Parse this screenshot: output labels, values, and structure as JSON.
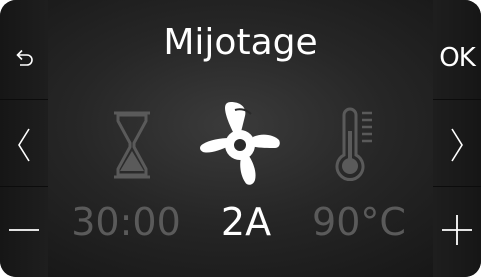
{
  "screen": {
    "title": "Mijotage"
  },
  "buttons": {
    "back_icon": "undo-arrow-icon",
    "prev_icon": "chevron-left-icon",
    "minus_icon": "minus-icon",
    "ok_label": "OK",
    "next_icon": "chevron-right-icon",
    "plus_icon": "plus-icon"
  },
  "params": [
    {
      "icon": "hourglass-icon",
      "value": "30:00",
      "active": false
    },
    {
      "icon": "blade-icon",
      "value": "2A",
      "active": true
    },
    {
      "icon": "thermometer-icon",
      "value": "90°C",
      "active": false
    }
  ],
  "colors": {
    "active": "#ffffff",
    "inactive": "#5a5a5a",
    "background": "#262626"
  }
}
